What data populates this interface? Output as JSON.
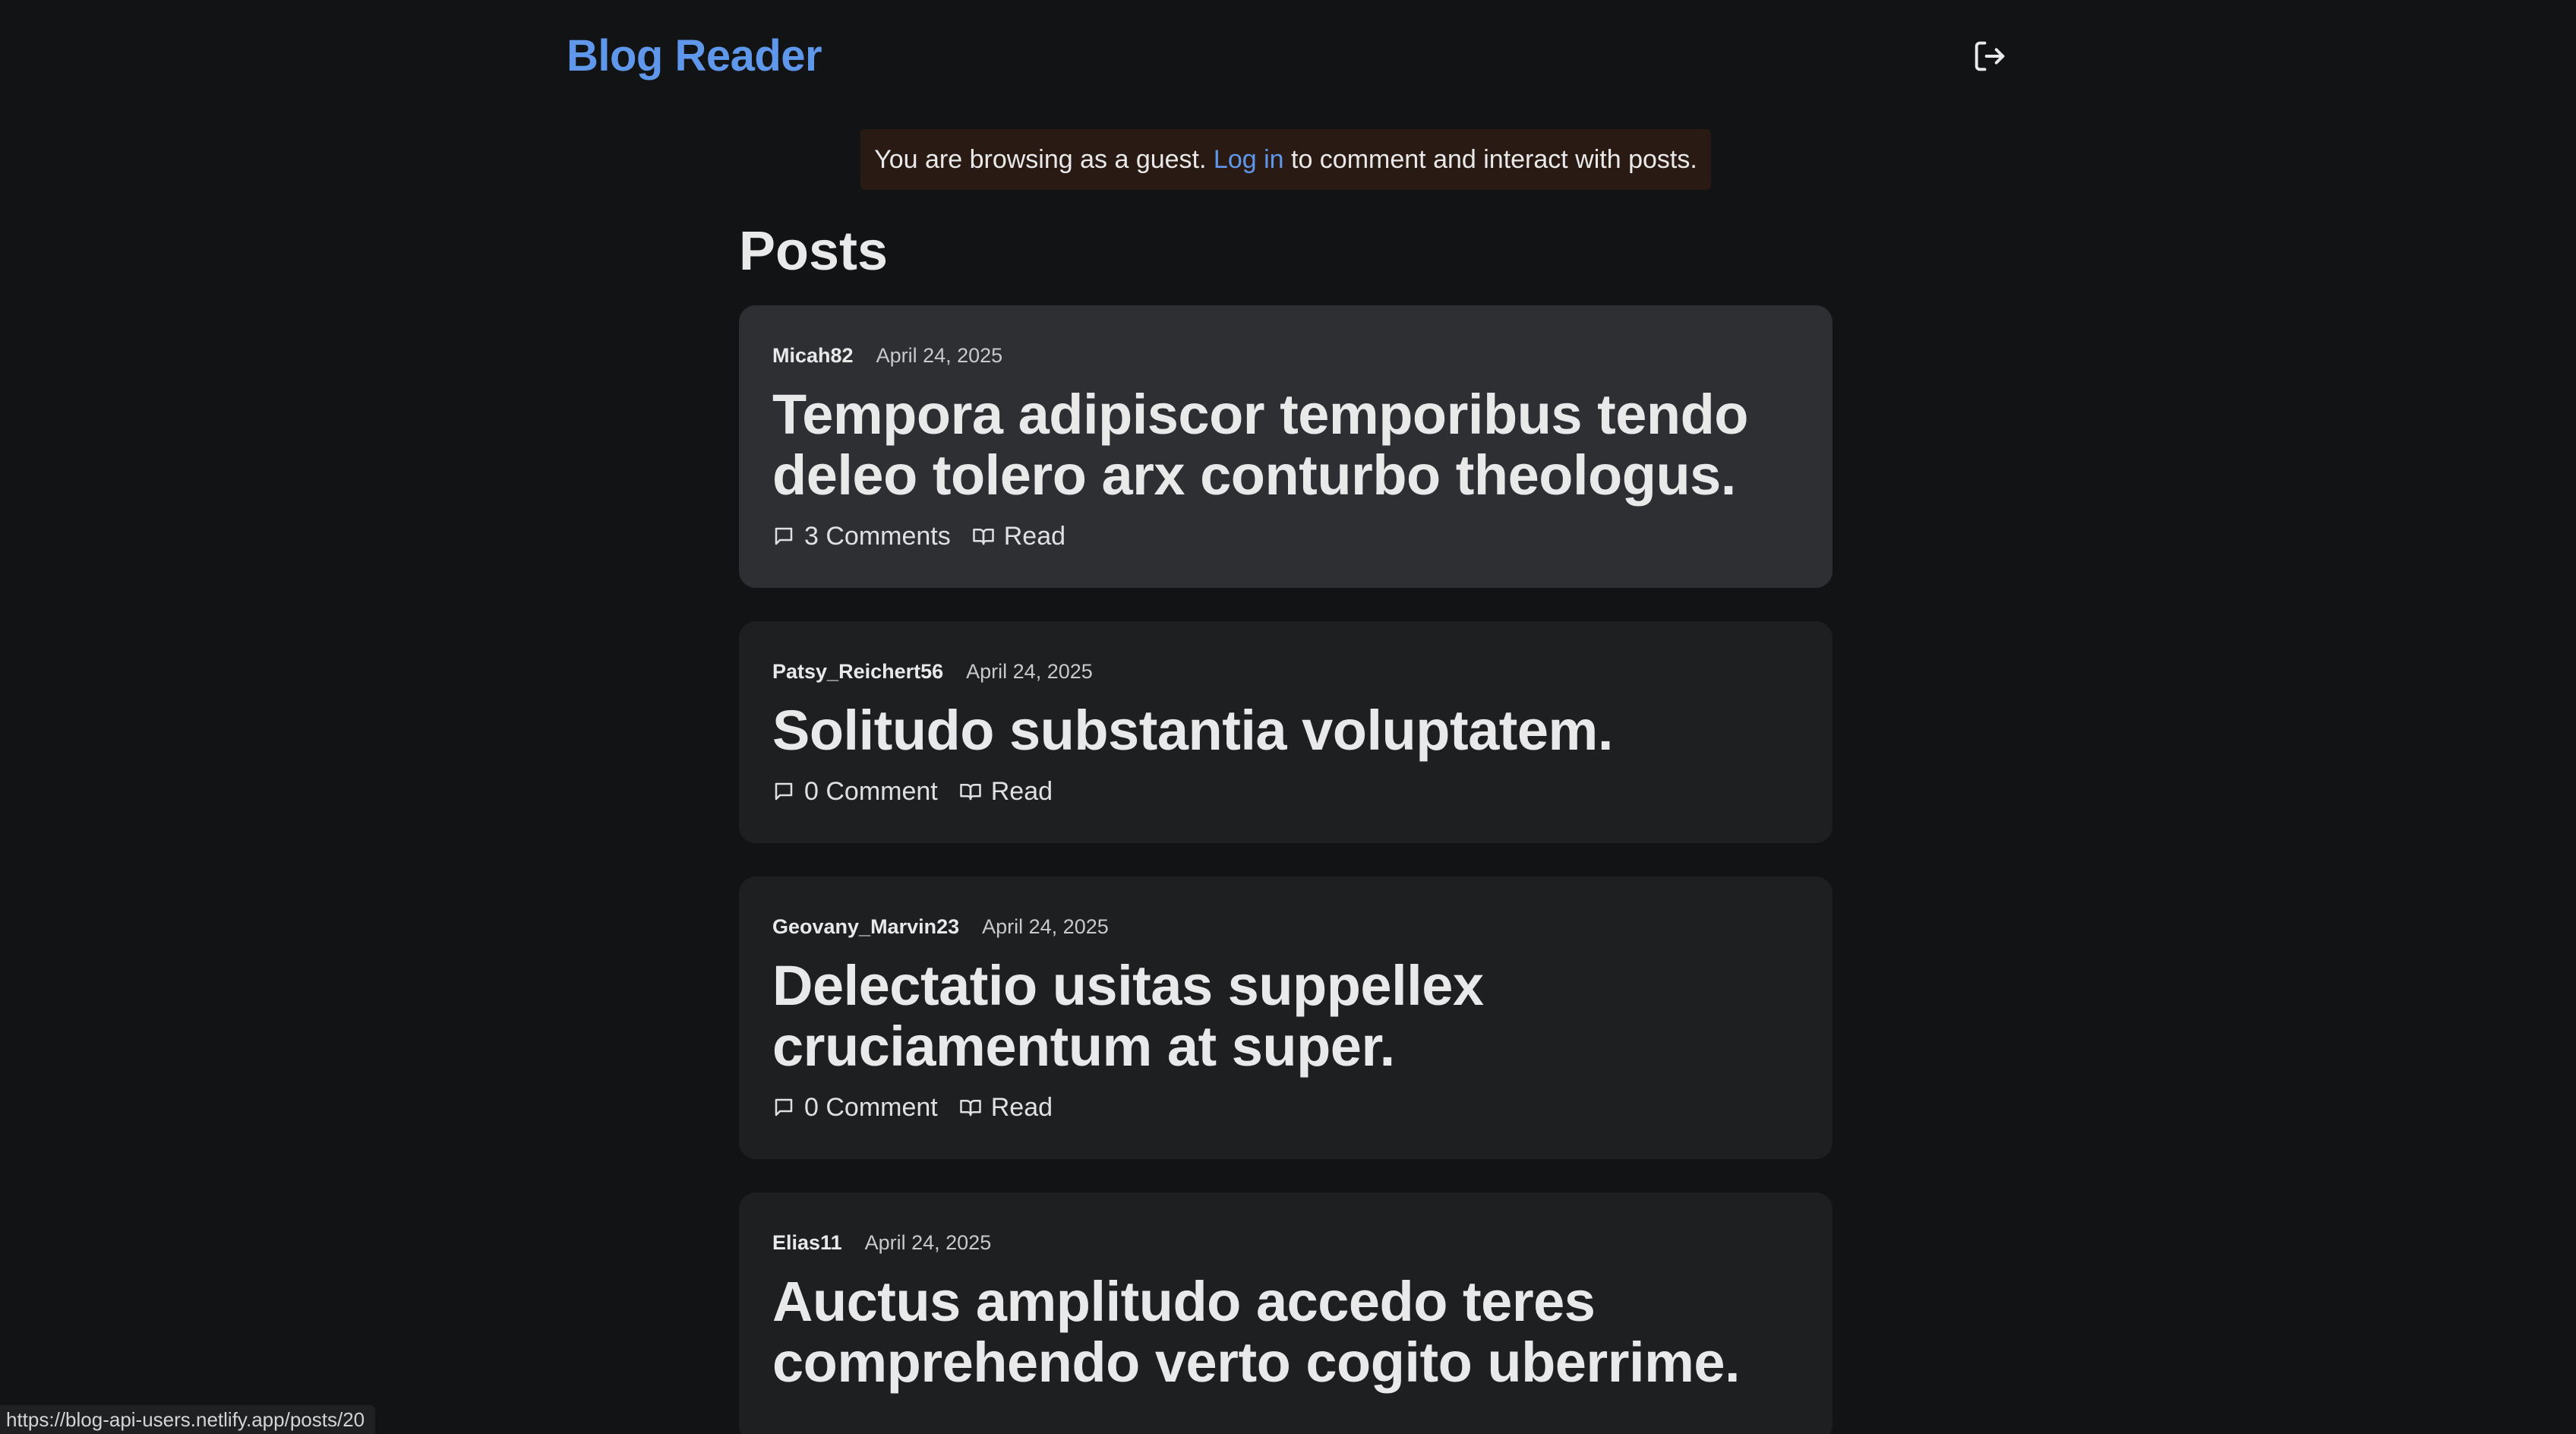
{
  "header": {
    "brand": "Blog Reader",
    "logout_icon": "logout-icon"
  },
  "banner": {
    "prefix": "You are browsing as a guest.",
    "link": "Log in",
    "suffix": "to comment and interact with posts."
  },
  "main": {
    "title": "Posts",
    "posts": [
      {
        "author": "Micah82",
        "date": "April 24, 2025",
        "title": "Tempora adipiscor temporibus tendo deleo tolero arx conturbo theologus.",
        "comments": "3 Comments",
        "read": "Read",
        "hovered": true
      },
      {
        "author": "Patsy_Reichert56",
        "date": "April 24, 2025",
        "title": "Solitudo substantia voluptatem.",
        "comments": "0 Comment",
        "read": "Read",
        "hovered": false
      },
      {
        "author": "Geovany_Marvin23",
        "date": "April 24, 2025",
        "title": "Delectatio usitas suppellex cruciamentum at super.",
        "comments": "0 Comment",
        "read": "Read",
        "hovered": false
      },
      {
        "author": "Elias11",
        "date": "April 24, 2025",
        "title": "Auctus amplitudo accedo teres comprehendo verto cogito uberrime.",
        "comments": "",
        "read": "",
        "hovered": false
      }
    ]
  },
  "status_bar": {
    "url": "https://blog-api-users.netlify.app/posts/20"
  },
  "colors": {
    "background": "#121314",
    "accent": "#5f97ea",
    "card": "#1e1f21",
    "card_hover": "#2d2f32",
    "banner": "#2a1a14"
  }
}
